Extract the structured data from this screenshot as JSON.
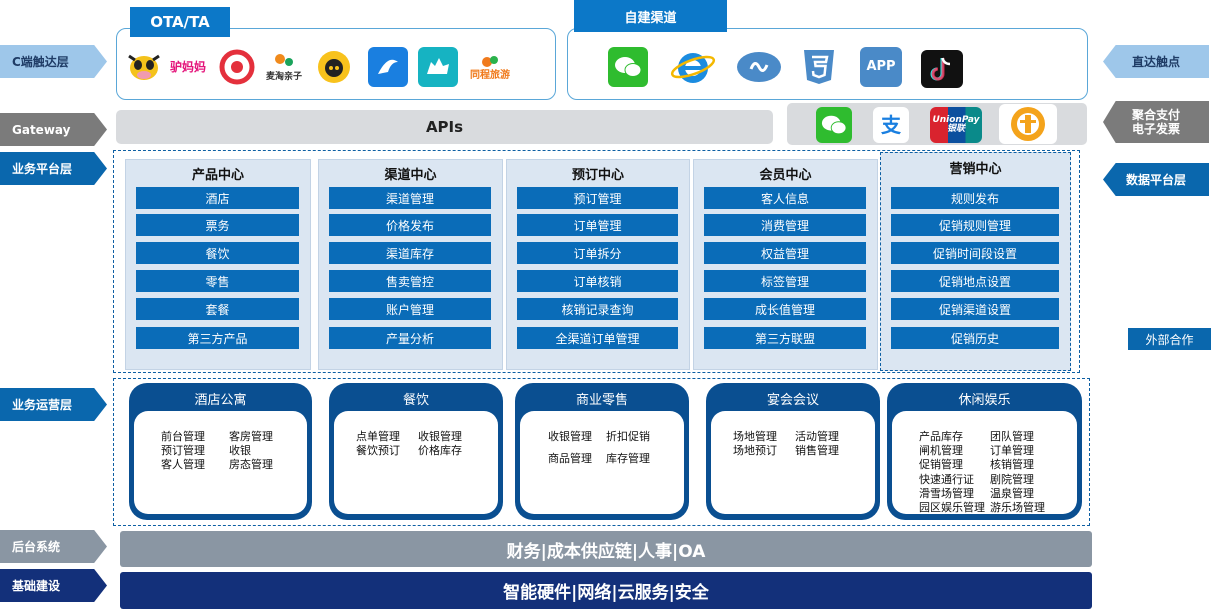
{
  "left_labels": {
    "c_end": "C端触达层",
    "gateway": "Gateway",
    "biz_platform": "业务平台层",
    "biz_ops": "业务运营层",
    "backend": "后台系统",
    "infra": "基础建设"
  },
  "right_labels": {
    "direct": "直达触点",
    "payment_line1": "聚合支付",
    "payment_line2": "电子发票",
    "data_platform": "数据平台层",
    "external": "外部合作"
  },
  "ota": {
    "tag": "OTA/TA",
    "icons": [
      {
        "icon": "cow-icon",
        "text": ""
      },
      {
        "icon": "donkey-mama-icon",
        "text": "驴妈妈"
      },
      {
        "icon": "qunar-icon",
        "text": ""
      },
      {
        "icon": "mama-qinzi-icon",
        "text": "麦淘亲子"
      },
      {
        "icon": "fliggy-pig-icon",
        "text": ""
      },
      {
        "icon": "ctrip-icon",
        "text": ""
      },
      {
        "icon": "qunar-camel-icon",
        "text": ""
      },
      {
        "icon": "tongcheng-icon",
        "text": "同程旅游"
      }
    ]
  },
  "self_channel": {
    "tag": "自建渠道",
    "icons": [
      {
        "icon": "wechat-icon",
        "text": ""
      },
      {
        "icon": "ie-browser-icon",
        "text": ""
      },
      {
        "icon": "miniprogram-icon",
        "text": ""
      },
      {
        "icon": "html5-icon",
        "text": ""
      },
      {
        "icon": "app-icon",
        "text": "APP"
      },
      {
        "icon": "tiktok-icon",
        "text": ""
      }
    ]
  },
  "gateway": {
    "apis": "APIs",
    "payments": [
      {
        "icon": "wechat-pay-icon",
        "text": ""
      },
      {
        "icon": "alipay-icon",
        "text": "支"
      },
      {
        "icon": "unionpay-icon",
        "text": "UnionPay 银联"
      },
      {
        "icon": "tax-invoice-icon",
        "text": ""
      }
    ]
  },
  "centers": [
    {
      "title": "产品中心",
      "items": [
        "酒店",
        "票务",
        "餐饮",
        "零售",
        "套餐",
        "第三方产品"
      ]
    },
    {
      "title": "渠道中心",
      "items": [
        "渠道管理",
        "价格发布",
        "渠道库存",
        "售卖管控",
        "账户管理",
        "产量分析"
      ]
    },
    {
      "title": "预订中心",
      "items": [
        "预订管理",
        "订单管理",
        "订单拆分",
        "订单核销",
        "核销记录查询",
        "全渠道订单管理"
      ]
    },
    {
      "title": "会员中心",
      "items": [
        "客人信息",
        "消费管理",
        "权益管理",
        "标签管理",
        "成长值管理",
        "第三方联盟"
      ]
    },
    {
      "title": "营销中心",
      "items": [
        "规则发布",
        "促销规则管理",
        "促销时间段设置",
        "促销地点设置",
        "促销渠道设置",
        "促销历史"
      ]
    }
  ],
  "operations": [
    {
      "title": "酒店公寓",
      "left": [
        "前台管理",
        "预订管理",
        "客人管理"
      ],
      "right": [
        "客房管理",
        "收银",
        "房态管理"
      ]
    },
    {
      "title": "餐饮",
      "left": [
        "点单管理",
        "餐饮预订"
      ],
      "right": [
        "收银管理",
        "价格库存"
      ]
    },
    {
      "title": "商业零售",
      "left": [
        "收银管理",
        "商品管理"
      ],
      "right": [
        "折扣促销",
        "库存管理"
      ]
    },
    {
      "title": "宴会会议",
      "left": [
        "场地管理",
        "场地预订"
      ],
      "right": [
        "活动管理",
        "销售管理"
      ]
    },
    {
      "title": "休闲娱乐",
      "left": [
        "产品库存",
        "闸机管理",
        "促销管理",
        "快速通行证",
        "滑雪场管理",
        "园区娱乐管理"
      ],
      "right": [
        "团队管理",
        "订单管理",
        "核销管理",
        "剧院管理",
        "温泉管理",
        "游乐场管理"
      ]
    }
  ],
  "backend_bar": "财务|成本供应链|人事|OA",
  "infra_bar": "智能硬件|网络|云服务|安全",
  "colors": {
    "primary_blue": "#0a6cb8",
    "dark_navy": "#13307a",
    "ops_blue": "#0a4f91",
    "backend_grey": "#8a96a3"
  }
}
